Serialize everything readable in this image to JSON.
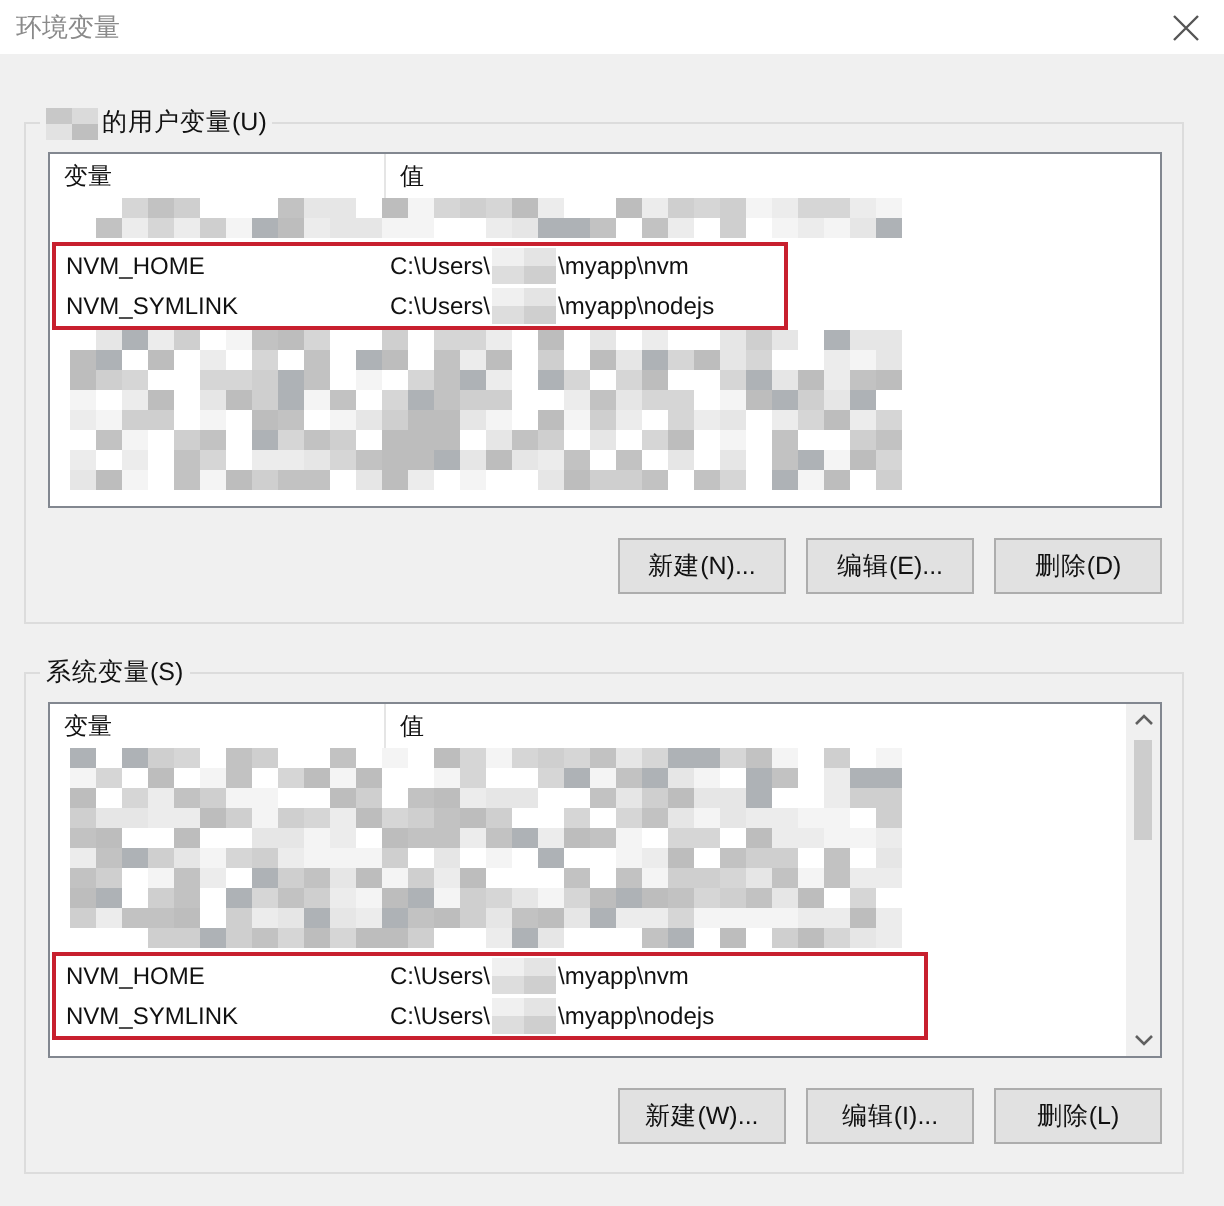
{
  "window": {
    "title": "环境变量"
  },
  "groups": [
    {
      "title": "的用户变量(U)",
      "title_prefix_hidden": true,
      "scrollable": false,
      "columns": [
        "变量",
        "值"
      ],
      "rows": [
        {
          "kind": "hidden"
        },
        {
          "kind": "highlight",
          "rows": [
            {
              "name": "NVM_HOME",
              "value_start": "C:\\Users\\",
              "value_end": "\\myapp\\nvm"
            },
            {
              "name": "NVM_SYMLINK",
              "value_start": "C:\\Users\\",
              "value_end": "\\myapp\\nodejs"
            }
          ]
        },
        {
          "kind": "hidden"
        },
        {
          "kind": "hidden"
        },
        {
          "kind": "hidden"
        },
        {
          "kind": "hidden"
        }
      ],
      "buttons": [
        "新建(N)...",
        "编辑(E)...",
        "删除(D)"
      ]
    },
    {
      "title": "系统变量(S)",
      "title_prefix_hidden": false,
      "scrollable": true,
      "columns": [
        "变量",
        "值"
      ],
      "rows": [
        {
          "kind": "hidden"
        },
        {
          "kind": "hidden"
        },
        {
          "kind": "hidden"
        },
        {
          "kind": "hidden"
        },
        {
          "kind": "hidden"
        },
        {
          "kind": "highlight",
          "rows": [
            {
              "name": "NVM_HOME",
              "value_start": "C:\\Users\\",
              "value_end": "\\myapp\\nvm"
            },
            {
              "name": "NVM_SYMLINK",
              "value_start": "C:\\Users\\",
              "value_end": "\\myapp\\nodejs"
            }
          ]
        }
      ],
      "buttons": [
        "新建(W)...",
        "编辑(I)...",
        "删除(L)"
      ]
    }
  ]
}
